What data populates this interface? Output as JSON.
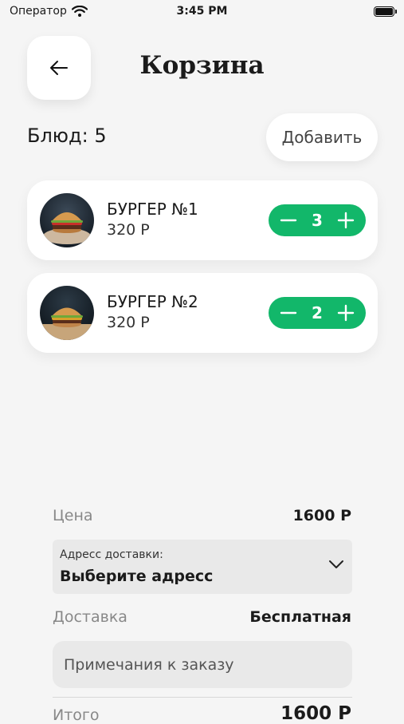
{
  "status_bar": {
    "carrier": "Оператор",
    "time": "3:45 PM"
  },
  "header": {
    "title": "Корзина"
  },
  "cart": {
    "count_label": "Блюд: 5",
    "add_label": "Добавить",
    "items": [
      {
        "name": "БУРГЕР №1",
        "price": "320 Р",
        "qty": "3"
      },
      {
        "name": "БУРГЕР №2",
        "price": "320 Р",
        "qty": "2"
      }
    ]
  },
  "summary": {
    "price_label": "Цена",
    "price_value": "1600 Р",
    "address_caption": "Адресс доставки:",
    "address_value": "Выберите адресс",
    "delivery_label": "Доставка",
    "delivery_value": "Бесплатная",
    "notes_placeholder": "Примечания к заказу",
    "total_label": "Итого",
    "total_value": "1600 Р"
  },
  "colors": {
    "accent": "#12b76a",
    "background": "#f5f5f5",
    "field": "#e9e9e9"
  },
  "icons": [
    "wifi-icon",
    "battery-icon",
    "arrow-left-icon",
    "minus-icon",
    "plus-icon",
    "chevron-down-icon"
  ]
}
